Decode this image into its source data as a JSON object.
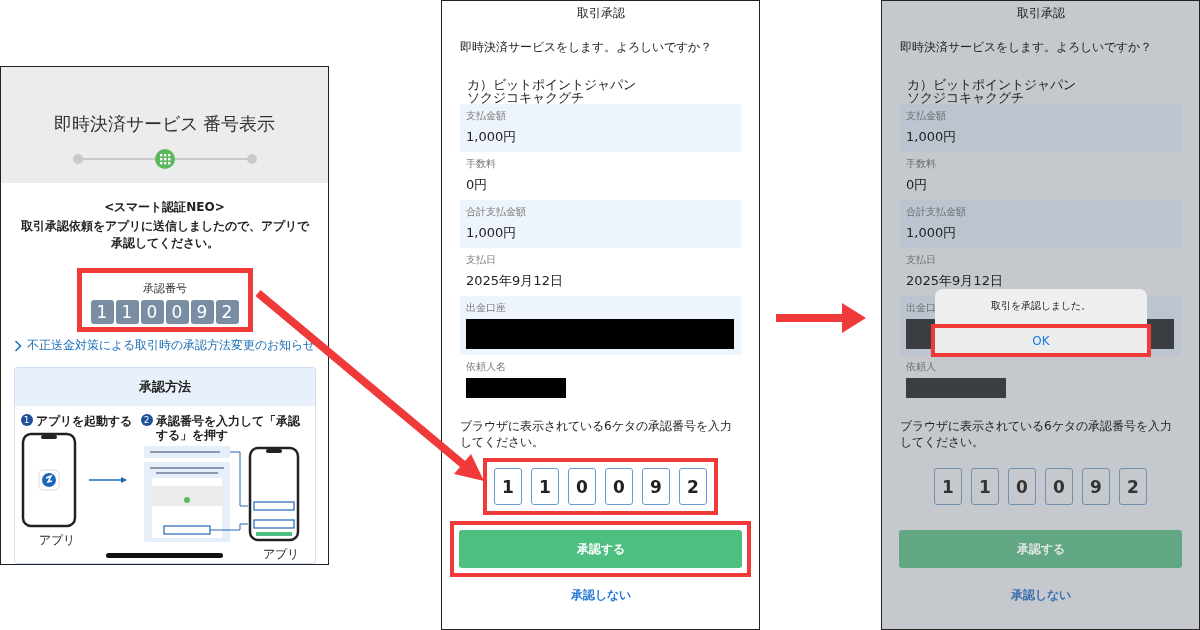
{
  "browser_screen": {
    "title": "即時決済サービス 番号表示",
    "heading": "<スマート認証NEO>",
    "message": "取引承認依頼をアプリに送信しましたので、アプリで承認してください。",
    "code_label": "承認番号",
    "code_digits": [
      "1",
      "1",
      "0",
      "0",
      "9",
      "2"
    ],
    "code_highlighted": true,
    "notice_link": "不正送金対策による取引時の承認方法変更のお知らせ",
    "method_card": {
      "title": "承認方法",
      "steps": [
        {
          "number": "1",
          "text": "アプリを起動する",
          "caption": "アプリ"
        },
        {
          "number": "2",
          "text": "承認番号を入力して「承認する」を押す",
          "caption": "アプリ"
        }
      ]
    }
  },
  "app_screens": [
    {
      "dimmed": false,
      "title": "取引承認",
      "question": "即時決済サービスをします。よろしいですか？",
      "payee": [
        "カ）ビットポイントジャパン",
        "ソクジコキャクグチ"
      ],
      "rows": [
        {
          "kind": "text",
          "label": "支払金額",
          "value": "1,000円"
        },
        {
          "kind": "text",
          "label": "手数料",
          "value": "0円"
        },
        {
          "kind": "text",
          "label": "合計支払金額",
          "value": "1,000円"
        },
        {
          "kind": "text",
          "label": "支払日",
          "value": "2025年9月12日"
        },
        {
          "kind": "account",
          "label": "出金口座"
        },
        {
          "kind": "name",
          "label": "依頼人名"
        }
      ],
      "instruction": "ブラウザに表示されている6ケタの承認番号を入力してください。",
      "code_digits": [
        "1",
        "1",
        "0",
        "0",
        "9",
        "2"
      ],
      "code_highlighted": true,
      "approve_button": "承認する",
      "approve_highlighted": true,
      "decline_link": "承認しない"
    },
    {
      "dimmed": true,
      "title": "取引承認",
      "question": "即時決済サービスをします。よろしいですか？",
      "payee": [
        "カ）ビットポイントジャパン",
        "ソクジコキャクグチ"
      ],
      "rows": [
        {
          "kind": "text",
          "label": "支払金額",
          "value": "1,000円"
        },
        {
          "kind": "text",
          "label": "手数料",
          "value": "0円"
        },
        {
          "kind": "text",
          "label": "合計支払金額",
          "value": "1,000円"
        },
        {
          "kind": "text",
          "label": "支払日",
          "value": "2025年9月12日"
        },
        {
          "kind": "account",
          "label": "出金口"
        },
        {
          "kind": "name",
          "label": "依頼人"
        }
      ],
      "instruction": "ブラウザに表示されている6ケタの承認番号を入力してください。",
      "code_digits": [
        "1",
        "1",
        "0",
        "0",
        "9",
        "2"
      ],
      "code_highlighted": false,
      "approve_button": "承認する",
      "approve_highlighted": false,
      "decline_link": "承認しない",
      "dialog": {
        "message": "取引を承認しました。",
        "ok_button": "OK",
        "ok_highlighted": true
      }
    }
  ]
}
